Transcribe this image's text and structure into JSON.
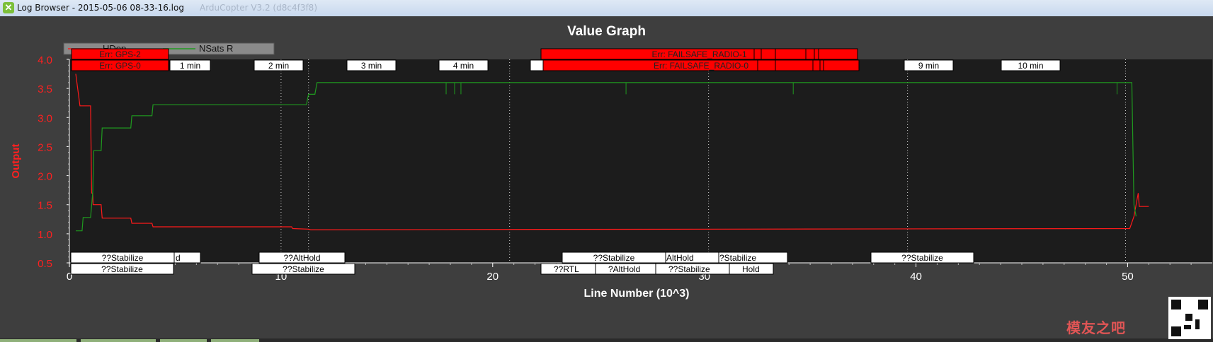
{
  "window": {
    "title": "Log Browser - 2015-05-06 08-33-16.log",
    "faint_title": "ArduCopter V3.2 (d8c4f3f8)"
  },
  "graph_title": "Value Graph",
  "legend": {
    "items": [
      "HDop",
      "NSats R"
    ]
  },
  "colors": {
    "hdop": "#ff1a1a",
    "nsats": "#1f9a1f",
    "err_box": "#ff0000",
    "plot_bg": "#1c1c1c",
    "axis_text": "#ffffff",
    "ylabel": "#ff2020"
  },
  "chart_data": {
    "type": "line",
    "title": "Value Graph",
    "xlabel": "Line Number (10^3)",
    "ylabel": "Output",
    "xlim": [
      0,
      54
    ],
    "ylim": [
      0.5,
      4.0
    ],
    "x_ticks": [
      "0",
      "10",
      "20",
      "30",
      "40",
      "50"
    ],
    "y_ticks": [
      "0.5",
      "1.0",
      "1.5",
      "2.0",
      "2.5",
      "3.0",
      "3.5",
      "4.0"
    ],
    "series": [
      {
        "name": "HDop",
        "x": [
          0.3,
          0.5,
          0.6,
          1.0,
          1.05,
          1.1,
          1.12,
          1.5,
          1.55,
          2.9,
          2.95,
          3.9,
          3.95,
          10.5,
          10.55,
          11.3,
          11.4,
          50.1,
          50.3,
          50.5,
          50.55,
          51
        ],
        "y": [
          3.75,
          3.2,
          3.2,
          3.2,
          1.7,
          1.7,
          1.5,
          1.5,
          1.27,
          1.27,
          1.18,
          1.18,
          1.12,
          1.12,
          1.09,
          1.08,
          1.07,
          1.09,
          1.3,
          1.7,
          1.47,
          1.47
        ]
      },
      {
        "name": "NSats R",
        "x": [
          0.3,
          0.6,
          0.65,
          1.0,
          1.1,
          1.15,
          1.5,
          1.55,
          2.9,
          2.95,
          3.9,
          3.95,
          11.2,
          11.3,
          11.6,
          11.7,
          50.2,
          50.25,
          50.3,
          50.4
        ],
        "y": [
          1.05,
          1.05,
          1.28,
          1.28,
          1.7,
          2.43,
          2.43,
          2.82,
          2.82,
          3.03,
          3.03,
          3.22,
          3.22,
          3.4,
          3.4,
          3.6,
          3.6,
          2.5,
          1.5,
          1.3
        ]
      }
    ],
    "time_markers": [
      "1 min",
      "2 min",
      "3 min",
      "4 min",
      "9 min",
      "10 min"
    ],
    "errors": [
      "Err: GPS-2",
      "Err: GPS-0",
      "Err: FAILSAFE_RADIO-1",
      "Err: FAILSAFE_RADIO-0"
    ],
    "mode_labels_top": [
      "??Stabilize",
      "d",
      "??AltHold",
      "??Stabilize",
      "AltHold",
      "?Stabilize",
      "??Stabilize"
    ],
    "mode_labels_bottom": [
      "??Stabilize",
      "??Stabilize",
      "??RTL",
      "?AltHold",
      "??Stabilize",
      "Hold"
    ],
    "grid": "vertical dotted lines at minute markers"
  },
  "watermark": "模友之吧"
}
